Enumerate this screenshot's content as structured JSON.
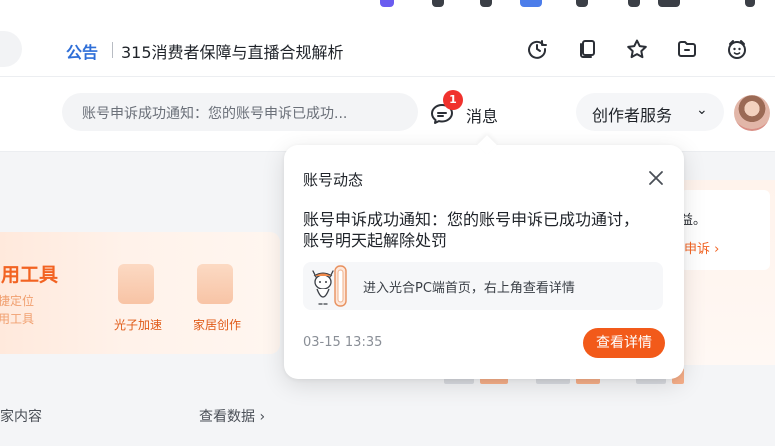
{
  "notice_bar": {
    "label": "公告",
    "title": "315消费者保障与直播合规解析",
    "icons": [
      "refresh-icon",
      "copy-icon",
      "star-icon",
      "folder-icon",
      "smiley-icon"
    ]
  },
  "header": {
    "ticker_text": "账号申诉成功通知：您的账号申诉已成功...",
    "messages_label": "消息",
    "messages_badge": "1",
    "creator_service_label": "创作者服务",
    "creator_service_chevron": "⌄"
  },
  "popover": {
    "title": "账号动态",
    "message": "账号申诉成功通知：您的账号申诉已成功通讨，账号明天起解除处罚",
    "hint": "进入光合PC端首页，右上角查看详情",
    "time": "03-15 13:35",
    "detail_button": "查看详情"
  },
  "tools": {
    "title": "常用工具",
    "subtitle_line1": "快捷定位",
    "subtitle_line2": "常用工具",
    "items": [
      {
        "label": "光子加速"
      },
      {
        "label": "家居创作"
      }
    ]
  },
  "side_card": {
    "snippet_1": "益。",
    "snippet_2": "申诉 ›"
  },
  "footer": {
    "section_label": "家内容",
    "view_data": "查看数据 ›"
  },
  "colors": {
    "accent": "#f25a1a",
    "badge": "#f0322d",
    "notice_blue": "#2f6fd8"
  }
}
